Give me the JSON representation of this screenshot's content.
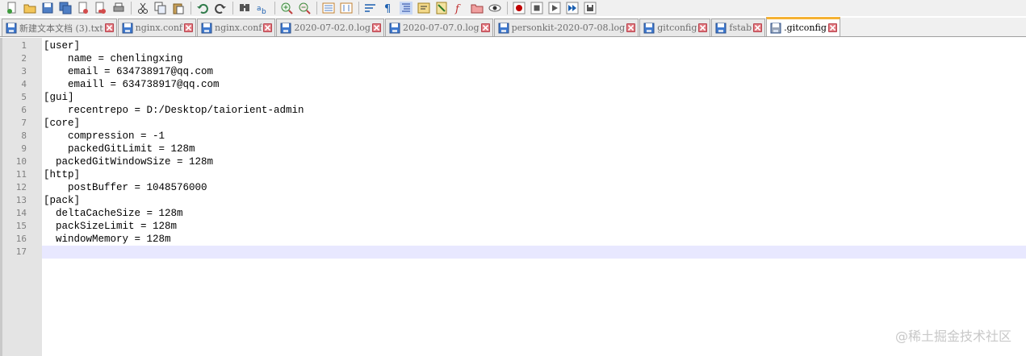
{
  "toolbar": {
    "groups": [
      [
        "new-file-icon",
        "open-file-icon",
        "save-icon",
        "save-all-icon",
        "close-icon",
        "close-all-icon",
        "print-icon"
      ],
      [
        "cut-icon",
        "copy-icon",
        "paste-icon"
      ],
      [
        "undo-icon",
        "redo-icon"
      ],
      [
        "find-icon",
        "replace-icon"
      ],
      [
        "zoom-in-icon",
        "zoom-out-icon"
      ],
      [
        "sync-vertical-icon",
        "sync-horizontal-icon"
      ],
      [
        "word-wrap-icon",
        "show-all-chars-icon",
        "indent-guide-icon",
        "language-icon",
        "doc-map-icon",
        "function-list-icon",
        "folder-workspace-icon",
        "monitoring-icon"
      ],
      [
        "record-macro-icon",
        "stop-record-icon",
        "play-macro-icon",
        "run-macro-multiple-icon",
        "save-macro-icon"
      ]
    ]
  },
  "tabs": [
    {
      "label": "新建文本文档 (3).txt",
      "active": false
    },
    {
      "label": "nginx.conf",
      "active": false
    },
    {
      "label": "nginx.conf",
      "active": false
    },
    {
      "label": "2020-07-02.0.log",
      "active": false
    },
    {
      "label": "2020-07-07.0.log",
      "active": false
    },
    {
      "label": "personkit-2020-07-08.log",
      "active": false
    },
    {
      "label": "gitconfig",
      "active": false
    },
    {
      "label": "fstab",
      "active": false
    },
    {
      "label": ".gitconfig",
      "active": true
    }
  ],
  "editor": {
    "current_line": 17,
    "lines": [
      {
        "num": "1",
        "text": "[user]"
      },
      {
        "num": "2",
        "text": "    name = chenlingxing"
      },
      {
        "num": "3",
        "text": "    email = 634738917@qq.com"
      },
      {
        "num": "4",
        "text": "    emaill = 634738917@qq.com"
      },
      {
        "num": "5",
        "text": "[gui]"
      },
      {
        "num": "6",
        "text": "    recentrepo = D:/Desktop/taiorient-admin"
      },
      {
        "num": "7",
        "text": "[core]"
      },
      {
        "num": "8",
        "text": "    compression = -1"
      },
      {
        "num": "9",
        "text": "    packedGitLimit = 128m"
      },
      {
        "num": "10",
        "text": "  packedGitWindowSize = 128m"
      },
      {
        "num": "11",
        "text": "[http]"
      },
      {
        "num": "12",
        "text": "    postBuffer = 1048576000"
      },
      {
        "num": "13",
        "text": "[pack]"
      },
      {
        "num": "14",
        "text": "  deltaCacheSize = 128m"
      },
      {
        "num": "15",
        "text": "  packSizeLimit = 128m"
      },
      {
        "num": "16",
        "text": "  windowMemory = 128m"
      },
      {
        "num": "17",
        "text": ""
      }
    ]
  },
  "watermark": "@稀土掘金技术社区",
  "colors": {
    "active_tab_accent": "#f5b133",
    "current_line_bg": "#e8e8ff",
    "gutter_bg": "#e4e4e4",
    "tab_close_bg": "#e27b82"
  }
}
